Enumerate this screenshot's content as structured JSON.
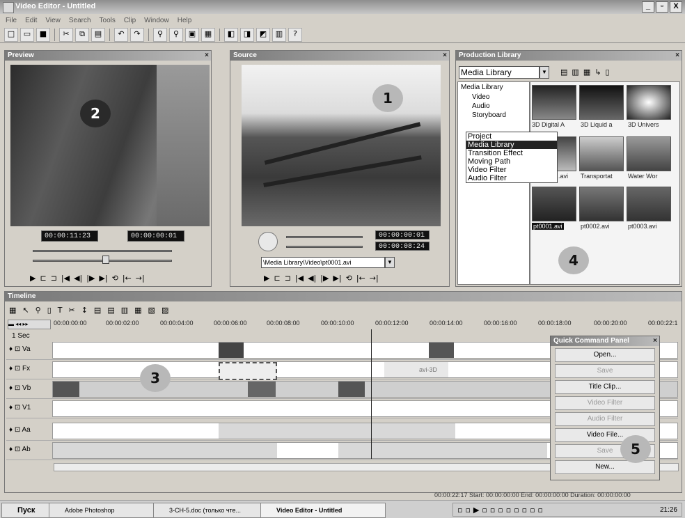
{
  "window": {
    "title": "Video Editor - Untitled",
    "controls": [
      "_",
      "▫",
      "X"
    ]
  },
  "menu": [
    "File",
    "Edit",
    "View",
    "Search",
    "Tools",
    "Clip",
    "Window",
    "Help"
  ],
  "preview": {
    "title": "Preview",
    "badge": "2",
    "timecode_left": "00:00:11:23",
    "timecode_right": "00:00:00:01"
  },
  "source": {
    "title": "Source",
    "badge": "1",
    "timecode_top": "00:00:00:01",
    "timecode_bottom": "00:00:08:24",
    "path": "\\Media Library\\Video\\pt0001.avi"
  },
  "library": {
    "title": "Production Library",
    "select_value": "Media Library",
    "tree": [
      "Media Library",
      "Video",
      "Audio",
      "Storyboard"
    ],
    "dropdown_options": [
      "Project",
      "Media Library",
      "Transition Effect",
      "Moving Path",
      "Video Filter",
      "Audio Filter"
    ],
    "dropdown_selected": "Media Library",
    "thumbs_row1": [
      "3D Digital A",
      "3D Liquid a",
      "3D Univers"
    ],
    "thumbs_row2": [
      ".avi",
      "Transportat",
      "Water Wor"
    ],
    "thumbs_row3": [
      "pt0001.avi",
      "pt0002.avi",
      "pt0003.avi"
    ],
    "badge": "4"
  },
  "timeline": {
    "title": "Timeline",
    "scale": "1 Sec",
    "ruler": [
      "00:00:00:00",
      "00:00:02:00",
      "00:00:04:00",
      "00:00:06:00",
      "00:00:08:00",
      "00:00:10:00",
      "00:00:12:00",
      "00:00:14:00",
      "00:00:16:00",
      "00:00:18:00",
      "00:00:20:00",
      "00:00:22:1"
    ],
    "tracks": [
      "Va",
      "Fx",
      "Vb",
      "V1",
      "Aa",
      "Ab"
    ],
    "badge": "3",
    "fx_clip_label": "avi-3D"
  },
  "quick_panel": {
    "title": "Quick Command Panel",
    "items": [
      {
        "label": "Open...",
        "enabled": true
      },
      {
        "label": "Save",
        "enabled": false
      },
      {
        "label": "Title Clip...",
        "enabled": true
      },
      {
        "label": "Video Filter",
        "enabled": false
      },
      {
        "label": "Audio Filter",
        "enabled": false
      },
      {
        "label": "Video File...",
        "enabled": true
      },
      {
        "label": "Save",
        "enabled": false
      },
      {
        "label": "New...",
        "enabled": true
      }
    ],
    "badge": "5"
  },
  "status": "00:00:22:17  Start: 00:00:00:00  End: 00:00:00:00  Duration: 00:00:00:00",
  "taskbar": {
    "start": "Пуск",
    "buttons": [
      "Adobe Photoshop",
      "3-СН-5.doc (только чте...",
      "Video Editor - Untitled"
    ],
    "clock": "21:26"
  }
}
